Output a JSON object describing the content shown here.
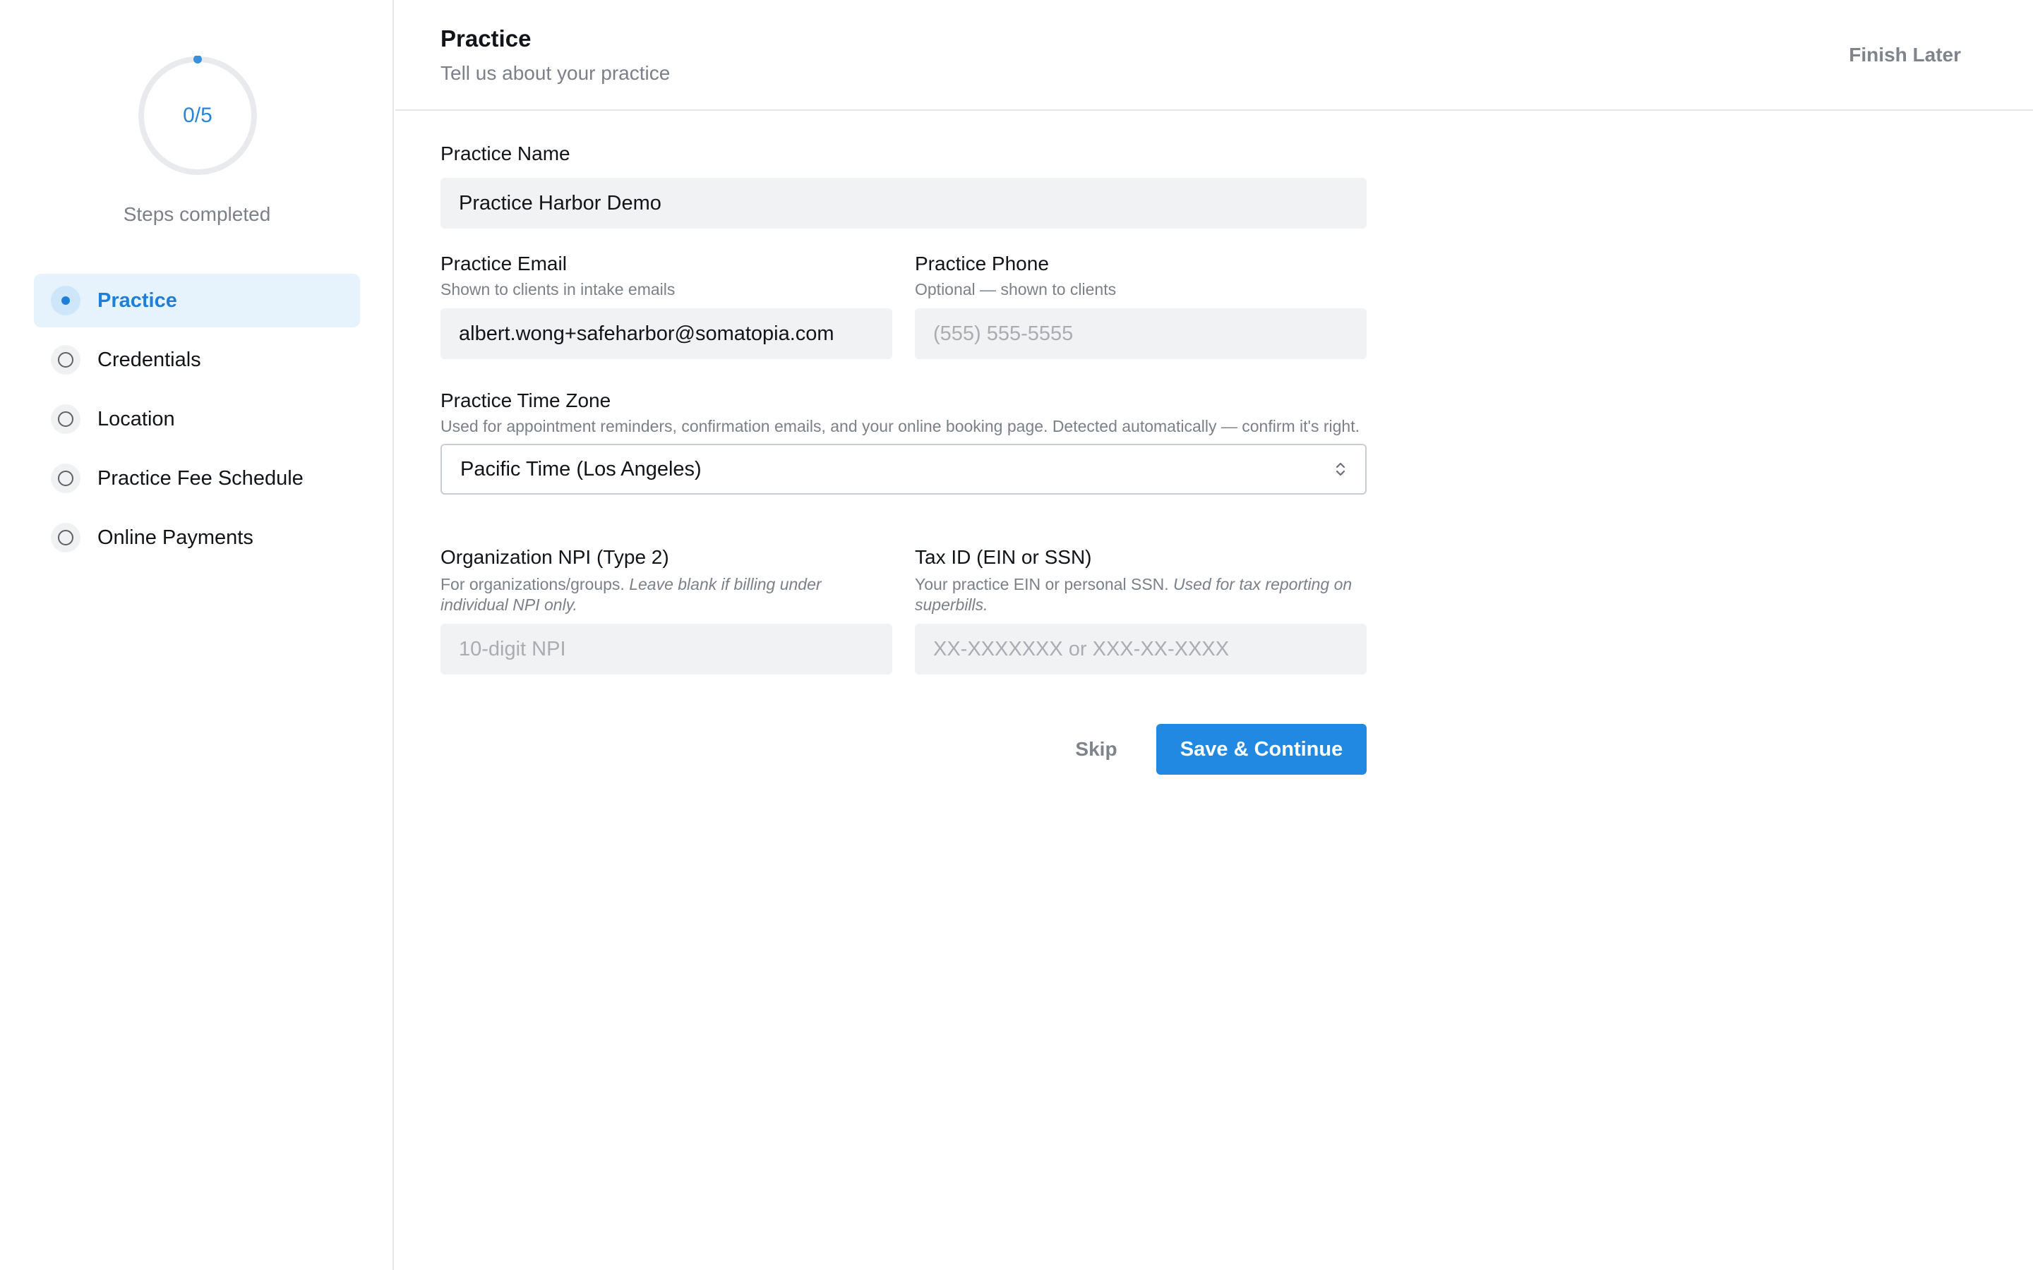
{
  "sidebar": {
    "progress": {
      "completed": 0,
      "total": 5,
      "text": "0/5"
    },
    "caption": "Steps completed",
    "items": [
      {
        "label": "Practice",
        "active": true
      },
      {
        "label": "Credentials",
        "active": false
      },
      {
        "label": "Location",
        "active": false
      },
      {
        "label": "Practice Fee Schedule",
        "active": false
      },
      {
        "label": "Online Payments",
        "active": false
      }
    ]
  },
  "header": {
    "title": "Practice",
    "subtitle": "Tell us about your practice",
    "finish_later": "Finish Later"
  },
  "form": {
    "practice_name": {
      "label": "Practice Name",
      "value": "Practice Harbor Demo"
    },
    "practice_email": {
      "label": "Practice Email",
      "hint": "Shown to clients in intake emails",
      "value": "albert.wong+safeharbor@somatopia.com"
    },
    "practice_phone": {
      "label": "Practice Phone",
      "hint": "Optional — shown to clients",
      "placeholder": "(555) 555-5555"
    },
    "time_zone": {
      "label": "Practice Time Zone",
      "hint": "Used for appointment reminders, confirmation emails, and your online booking page. Detected automatically — confirm it's right.",
      "value": "Pacific Time (Los Angeles)"
    },
    "npi": {
      "label": "Organization NPI (Type 2)",
      "hint_plain": "For organizations/groups. ",
      "hint_italic": "Leave blank if billing under individual NPI only.",
      "placeholder": "10-digit NPI"
    },
    "tax_id": {
      "label": "Tax ID (EIN or SSN)",
      "hint_plain": "Your practice EIN or personal SSN. ",
      "hint_italic": "Used for tax reporting on superbills.",
      "placeholder": "XX-XXXXXXX or XXX-XX-XXXX"
    }
  },
  "actions": {
    "skip": "Skip",
    "save": "Save & Continue"
  },
  "colors": {
    "accent": "#2289e3",
    "active_bg": "#e6f3fd",
    "input_bg": "#f1f2f4"
  }
}
